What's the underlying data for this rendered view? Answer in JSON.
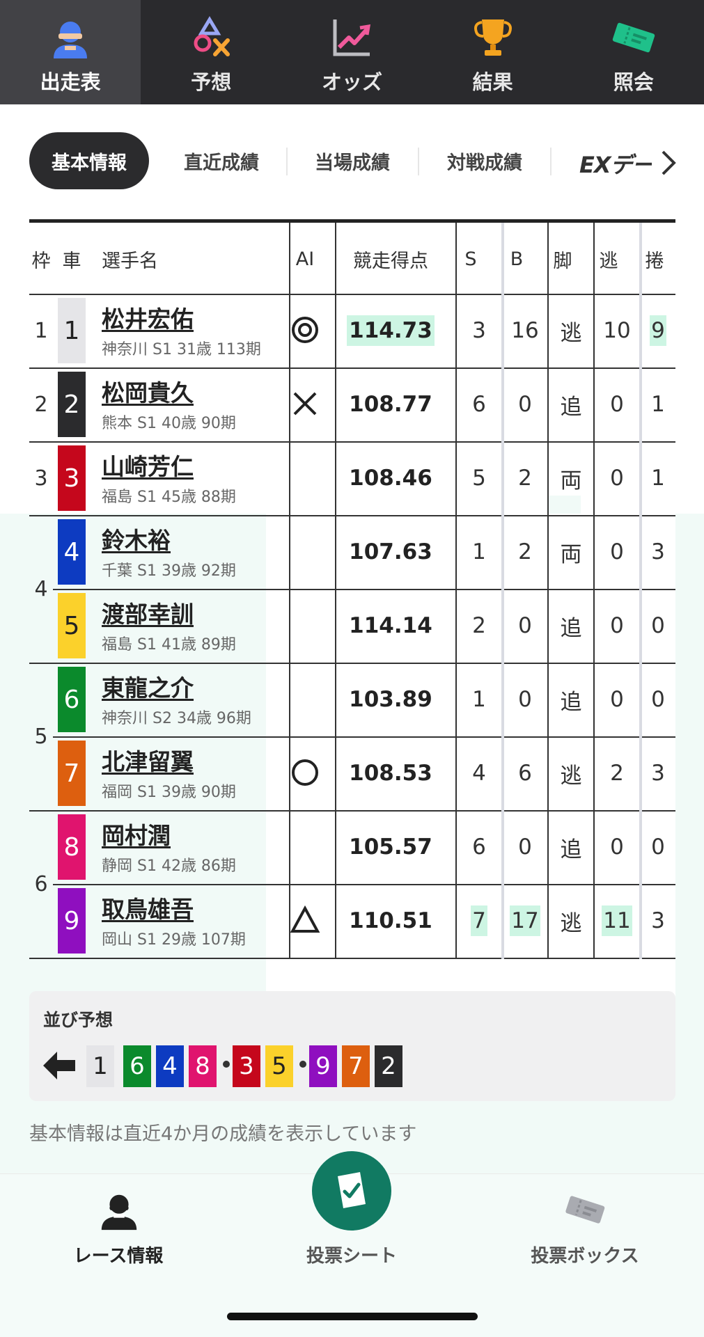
{
  "top_nav": [
    {
      "label": "出走表",
      "icon": "person-icon",
      "active": true
    },
    {
      "label": "予想",
      "icon": "shapes-icon",
      "active": false
    },
    {
      "label": "オッズ",
      "icon": "chart-up-icon",
      "active": false
    },
    {
      "label": "結果",
      "icon": "trophy-icon",
      "active": false
    },
    {
      "label": "照会",
      "icon": "ticket-icon",
      "active": false
    }
  ],
  "sub_tabs": {
    "active": "基本情報",
    "items": [
      "直近成績",
      "当場成績",
      "対戦成績"
    ],
    "ex_label": "EXデータ"
  },
  "table": {
    "headers": {
      "waku": "枠",
      "car": "車",
      "name": "選手名",
      "ai": "AI",
      "score": "競走得点",
      "s": "S",
      "b": "B",
      "kyaku": "脚",
      "nige": "逃",
      "makuri": "捲"
    },
    "waku_labels": [
      "1",
      "2",
      "3",
      "4",
      "5",
      "6"
    ],
    "rows": [
      {
        "car": "1",
        "name": "松井宏佑",
        "meta": "神奈川 S1 31歳 113期",
        "ai": "double-circle",
        "score": "114.73",
        "s": "3",
        "b": "16",
        "kyaku": "逃",
        "nige": "10",
        "makuri": "9"
      },
      {
        "car": "2",
        "name": "松岡貴久",
        "meta": "熊本 S1 40歳 90期",
        "ai": "cross",
        "score": "108.77",
        "s": "6",
        "b": "0",
        "kyaku": "追",
        "nige": "0",
        "makuri": "1"
      },
      {
        "car": "3",
        "name": "山崎芳仁",
        "meta": "福島 S1 45歳 88期",
        "ai": "",
        "score": "108.46",
        "s": "5",
        "b": "2",
        "kyaku": "両",
        "nige": "0",
        "makuri": "1"
      },
      {
        "car": "4",
        "name": "鈴木裕",
        "meta": "千葉 S1 39歳 92期",
        "ai": "",
        "score": "107.63",
        "s": "1",
        "b": "2",
        "kyaku": "両",
        "nige": "0",
        "makuri": "3"
      },
      {
        "car": "5",
        "name": "渡部幸訓",
        "meta": "福島 S1 41歳 89期",
        "ai": "",
        "score": "114.14",
        "s": "2",
        "b": "0",
        "kyaku": "追",
        "nige": "0",
        "makuri": "0"
      },
      {
        "car": "6",
        "name": "東龍之介",
        "meta": "神奈川 S2 34歳 96期",
        "ai": "",
        "score": "103.89",
        "s": "1",
        "b": "0",
        "kyaku": "追",
        "nige": "0",
        "makuri": "0"
      },
      {
        "car": "7",
        "name": "北津留翼",
        "meta": "福岡 S1 39歳 90期",
        "ai": "circle",
        "score": "108.53",
        "s": "4",
        "b": "6",
        "kyaku": "逃",
        "nige": "2",
        "makuri": "3"
      },
      {
        "car": "8",
        "name": "岡村潤",
        "meta": "静岡 S1 42歳 86期",
        "ai": "",
        "score": "105.57",
        "s": "6",
        "b": "0",
        "kyaku": "追",
        "nige": "0",
        "makuri": "0"
      },
      {
        "car": "9",
        "name": "取鳥雄吾",
        "meta": "岡山 S1 29歳 107期",
        "ai": "triangle",
        "score": "110.51",
        "s": "7",
        "b": "17",
        "kyaku": "逃",
        "nige": "11",
        "makuri": "3"
      }
    ],
    "car_colors": {
      "1": {
        "bg": "#e5e5e8",
        "fg": "#222222"
      },
      "2": {
        "bg": "#2b2b2d",
        "fg": "#ffffff"
      },
      "3": {
        "bg": "#c5071c",
        "fg": "#ffffff"
      },
      "4": {
        "bg": "#0d3bc1",
        "fg": "#ffffff"
      },
      "5": {
        "bg": "#fbd12b",
        "fg": "#222222"
      },
      "6": {
        "bg": "#0b8a2c",
        "fg": "#ffffff"
      },
      "7": {
        "bg": "#dd5f0f",
        "fg": "#ffffff"
      },
      "8": {
        "bg": "#e0146e",
        "fg": "#ffffff"
      },
      "9": {
        "bg": "#8f0fbf",
        "fg": "#ffffff"
      }
    },
    "highlight_color": "#cdf5e3"
  },
  "narabi": {
    "title": "並び予想",
    "sequence": [
      "1",
      "6",
      "4",
      "8",
      "3",
      "5",
      "9",
      "7",
      "2"
    ]
  },
  "note": "基本情報は直近4か月の成績を表示しています",
  "bottom_nav": [
    {
      "label": "レース情報",
      "icon": "person-icon"
    },
    {
      "label": "投票シート",
      "icon": "check-sheet-icon"
    },
    {
      "label": "投票ボックス",
      "icon": "ticket-icon"
    }
  ],
  "accent_color": "#117a62"
}
